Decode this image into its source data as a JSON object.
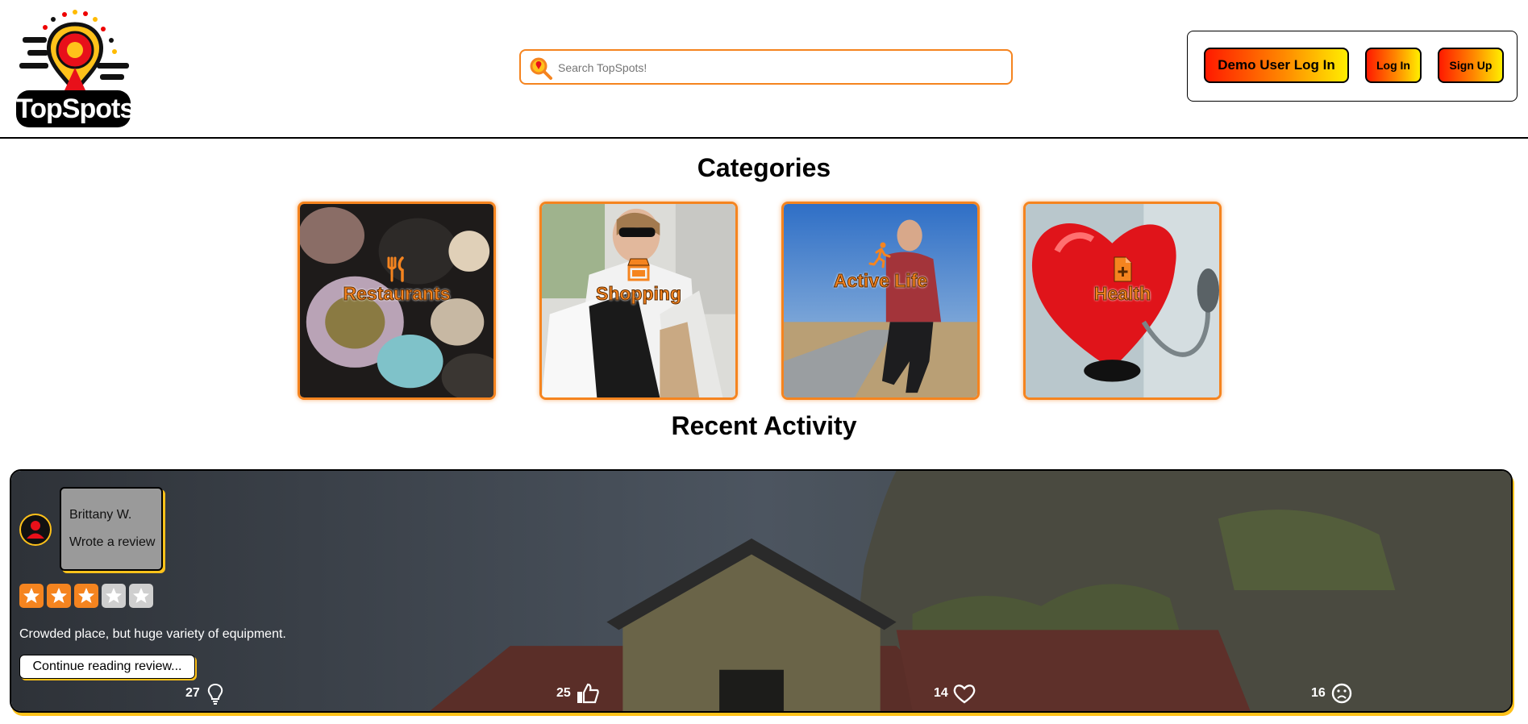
{
  "header": {
    "logo_text": "TopSpots",
    "search_placeholder": "Search TopSpots!",
    "buttons": {
      "demo": "Demo User Log In",
      "login": "Log In",
      "signup": "Sign Up"
    }
  },
  "categories": {
    "title": "Categories",
    "items": [
      {
        "label": "Restaurants",
        "icon": "utensils-icon"
      },
      {
        "label": "Shopping",
        "icon": "store-icon"
      },
      {
        "label": "Active Life",
        "icon": "person-running-icon"
      },
      {
        "label": "Health",
        "icon": "medical-file-icon"
      }
    ]
  },
  "recent": {
    "title": "Recent Activity",
    "card": {
      "user_name": "Brittany W.",
      "action": "Wrote a review",
      "rating": 3,
      "rating_max": 5,
      "review_text": "Crowded place, but huge variety of equipment.",
      "continue_label": "Continue reading review...",
      "reactions": [
        {
          "count": "27",
          "icon": "lightbulb-icon"
        },
        {
          "count": "25",
          "icon": "thumbs-up-icon"
        },
        {
          "count": "14",
          "icon": "heart-icon"
        },
        {
          "count": "16",
          "icon": "sad-face-icon"
        }
      ]
    }
  },
  "colors": {
    "accent": "#f5841f",
    "highlight": "#ffc21a",
    "gradient_start": "#ff1a00",
    "gradient_end": "#ffee00"
  }
}
